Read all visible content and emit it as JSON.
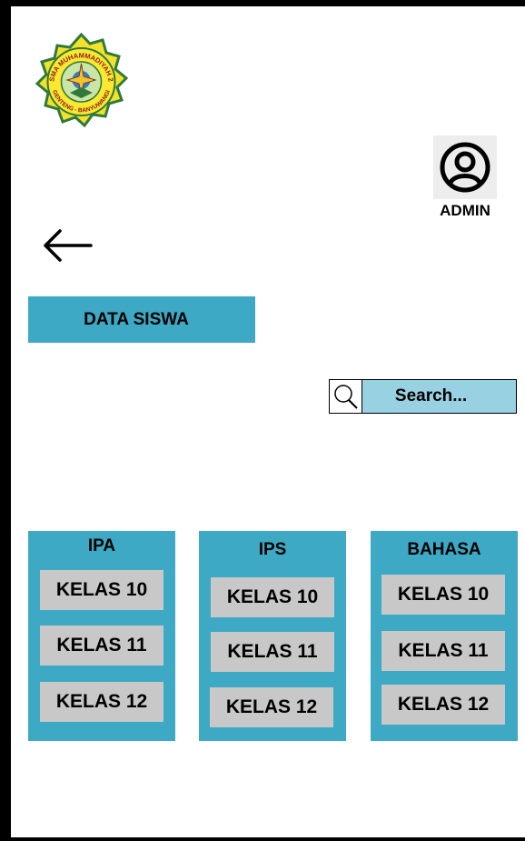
{
  "header": {
    "logo_text": [
      "SMA MUHAMMADIYAH 2",
      "GENTENG - BANYUWANGI"
    ],
    "admin_label": "ADMIN"
  },
  "page": {
    "title": "DATA SISWA",
    "search_placeholder": "Search..."
  },
  "colors": {
    "accent": "#3ea9c5",
    "search_bg": "#97d1e2",
    "button_gray": "#c8c8c8"
  },
  "panels": [
    {
      "title": "IPA",
      "items": [
        "KELAS 10",
        "KELAS 11",
        "KELAS 12"
      ]
    },
    {
      "title": "IPS",
      "items": [
        "KELAS 10",
        "KELAS 11",
        "KELAS 12"
      ]
    },
    {
      "title": "BAHASA",
      "items": [
        "KELAS 10",
        "KELAS 11",
        "KELAS 12"
      ]
    }
  ]
}
